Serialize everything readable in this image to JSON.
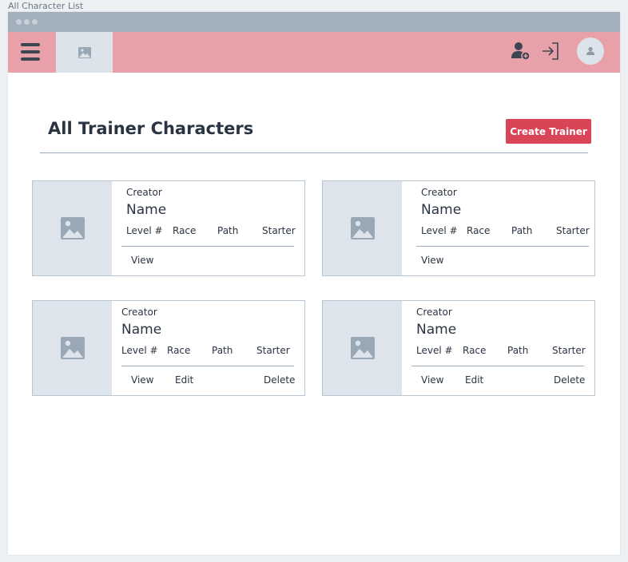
{
  "page_label": "All Character List",
  "header": {
    "title": "All Trainer Characters",
    "create_button": "Create Trainer"
  },
  "cards": [
    {
      "creator": "Creator",
      "name": "Name",
      "level": "Level #",
      "race": "Race",
      "path": "Path",
      "starter": "Starter",
      "view": "View"
    },
    {
      "creator": "Creator",
      "name": "Name",
      "level": "Level #",
      "race": "Race",
      "path": "Path",
      "starter": "Starter",
      "view": "View"
    },
    {
      "creator": "Creator",
      "name": "Name",
      "level": "Level #",
      "race": "Race",
      "path": "Path",
      "starter": "Starter",
      "view": "View",
      "edit": "Edit",
      "delete": "Delete"
    },
    {
      "creator": "Creator",
      "name": "Name",
      "level": "Level #",
      "race": "Race",
      "path": "Path",
      "starter": "Starter",
      "view": "View",
      "edit": "Edit",
      "delete": "Delete"
    }
  ],
  "icons": {
    "menu": "hamburger-menu-icon",
    "logo": "image-placeholder-icon",
    "add_user": "add-user-icon",
    "login": "login-icon",
    "avatar": "user-avatar-icon"
  },
  "colors": {
    "navbar": "#e9a1a9",
    "accent": "#d94457",
    "placeholder": "#dee4eb"
  }
}
